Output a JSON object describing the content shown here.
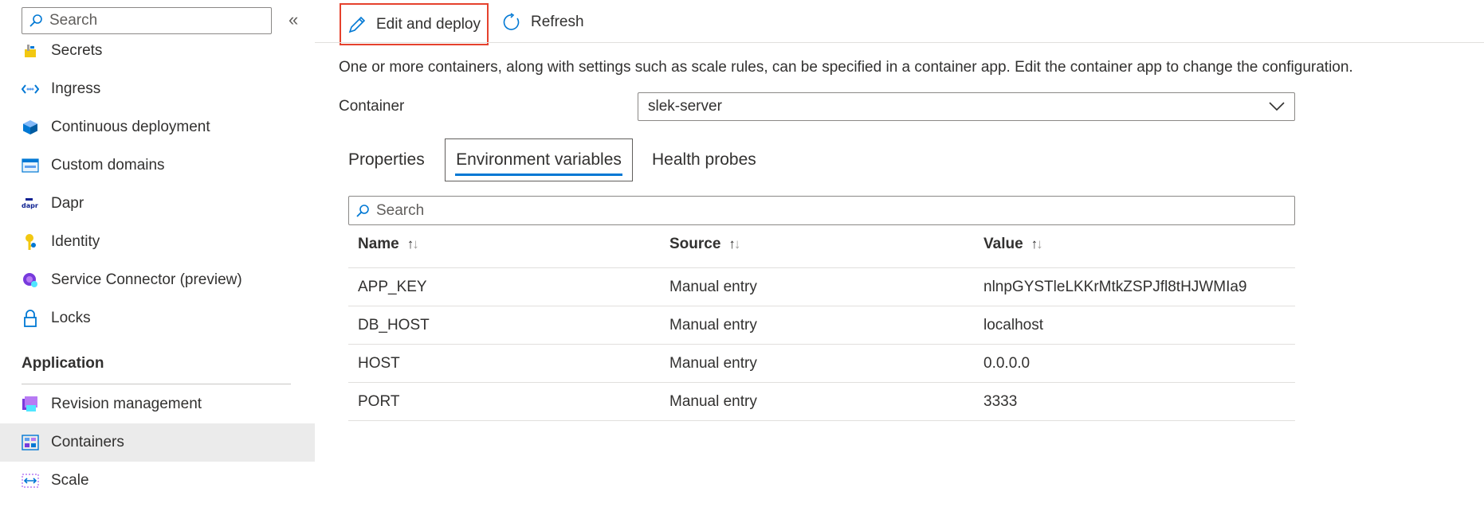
{
  "sidebar": {
    "search_placeholder": "Search",
    "collapse_glyph": "«",
    "items": [
      {
        "label": "Secrets",
        "icon": "key-lock-icon"
      },
      {
        "label": "Ingress",
        "icon": "ingress-icon"
      },
      {
        "label": "Continuous deployment",
        "icon": "cube-icon"
      },
      {
        "label": "Custom domains",
        "icon": "www-icon"
      },
      {
        "label": "Dapr",
        "icon": "dapr-icon"
      },
      {
        "label": "Identity",
        "icon": "identity-key-icon"
      },
      {
        "label": "Service Connector (preview)",
        "icon": "service-connector-icon"
      },
      {
        "label": "Locks",
        "icon": "lock-icon"
      }
    ],
    "group_title": "Application",
    "app_items": [
      {
        "label": "Revision management",
        "icon": "revision-icon"
      },
      {
        "label": "Containers",
        "icon": "containers-icon",
        "selected": true
      },
      {
        "label": "Scale",
        "icon": "scale-icon"
      }
    ]
  },
  "toolbar": {
    "edit_label": "Edit and deploy",
    "refresh_label": "Refresh"
  },
  "main": {
    "description": "One or more containers, along with settings such as scale rules, can be specified in a container app. Edit the container app to change the configuration.",
    "container_label": "Container",
    "container_value": "slek-server",
    "tabs": [
      {
        "label": "Properties"
      },
      {
        "label": "Environment variables",
        "active": true
      },
      {
        "label": "Health probes"
      }
    ],
    "search_placeholder": "Search",
    "columns": [
      "Name",
      "Source",
      "Value"
    ],
    "rows": [
      {
        "name": "APP_KEY",
        "source": "Manual entry",
        "value": "nlnpGYSTleLKKrMtkZSPJfl8tHJWMIa9"
      },
      {
        "name": "DB_HOST",
        "source": "Manual entry",
        "value": "localhost"
      },
      {
        "name": "HOST",
        "source": "Manual entry",
        "value": "0.0.0.0"
      },
      {
        "name": "PORT",
        "source": "Manual entry",
        "value": "3333"
      }
    ]
  },
  "colors": {
    "accent": "#0078d4",
    "highlight_border": "#e5412d",
    "selected_bg": "#ebebeb"
  }
}
